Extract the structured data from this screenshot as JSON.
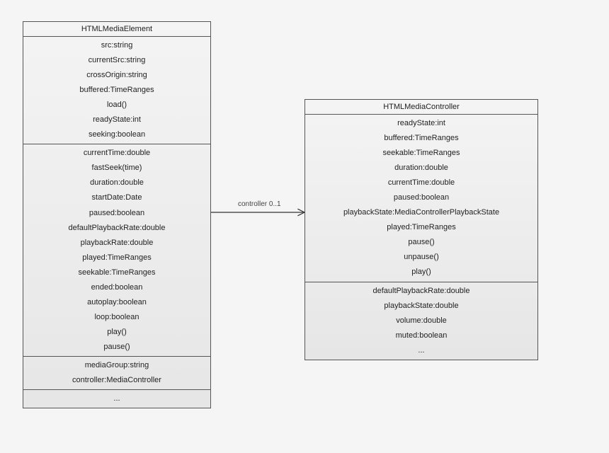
{
  "left": {
    "title": "HTMLMediaElement",
    "sections": [
      [
        "src:string",
        "currentSrc:string",
        "crossOrigin:string",
        "buffered:TimeRanges",
        "load()",
        "readyState:int",
        "seeking:boolean"
      ],
      [
        "currentTime:double",
        "fastSeek(time)",
        "duration:double",
        "startDate:Date",
        "paused:boolean",
        "defaultPlaybackRate:double",
        "playbackRate:double",
        "played:TimeRanges",
        "seekable:TimeRanges",
        "ended:boolean",
        "autoplay:boolean",
        "loop:boolean",
        "play()",
        "pause()"
      ],
      [
        "mediaGroup:string",
        "controller:MediaController"
      ],
      [
        "..."
      ]
    ]
  },
  "right": {
    "title": "HTMLMediaController",
    "sections": [
      [
        "readyState:int",
        "buffered:TimeRanges",
        "seekable:TimeRanges",
        "duration:double",
        "currentTime:double",
        "paused:boolean",
        "playbackState:MediaControllerPlaybackState",
        "played:TimeRanges",
        "pause()",
        "unpause()",
        "play()"
      ],
      [
        "defaultPlaybackRate:double",
        "playbackState:double",
        "volume:double",
        "muted:boolean",
        "..."
      ]
    ]
  },
  "association": {
    "label": "controller  0..1"
  }
}
